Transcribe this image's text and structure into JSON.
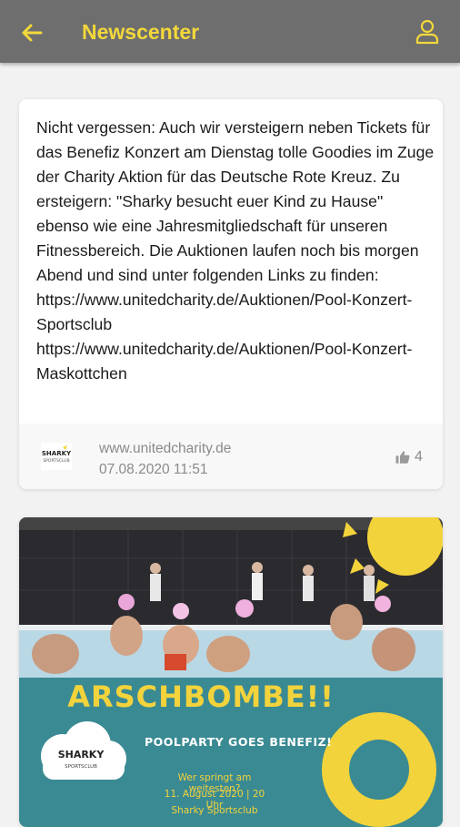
{
  "appbar": {
    "title": "Newscenter",
    "back_icon": "arrow-left-icon",
    "profile_icon": "user-icon",
    "background": "#6e6e6e",
    "accent": "#f2d83a"
  },
  "posts": [
    {
      "text": "Nicht vergessen: Auch wir versteigern neben Tickets für das Benefiz Konzert am Dienstag tolle Goodies im Zuge der Charity Aktion für das Deutsche Rote Kreuz. Zu ersteigern: \"Sharky besucht euer Kind zu Hause\" ebenso wie eine Jahresmitgliedschaft für unseren Fitnessbereich. Die Auktionen laufen noch bis morgen Abend und sind unter folgenden Links zu finden:\nhttps://www.unitedcharity.de/Auktionen/Pool-Konzert-Sportsclub\nhttps://www.unitedcharity.de/Auktionen/Pool-Konzert-Maskottchen",
      "source": "www.unitedcharity.de",
      "date": "07.08.2020 11:51",
      "likes": "4",
      "like_icon": "thumbs-up-icon",
      "logo_icon": "sharky-sportsclub-logo"
    },
    {
      "image": {
        "headline": "ARSCHBOMBE!!",
        "subheadline": "POOLPARTY GOES BENEFIZ!",
        "question": "Wer springt am weitesten?",
        "date_time": "11. August 2020 | 20 Uhr",
        "location": "Sharky Sportsclub",
        "logo_text": "SHARKY",
        "logo_subtext": "SPORTSCLUB",
        "colors": {
          "teal": "#3a8a93",
          "yellow": "#f3d33b"
        }
      }
    }
  ]
}
